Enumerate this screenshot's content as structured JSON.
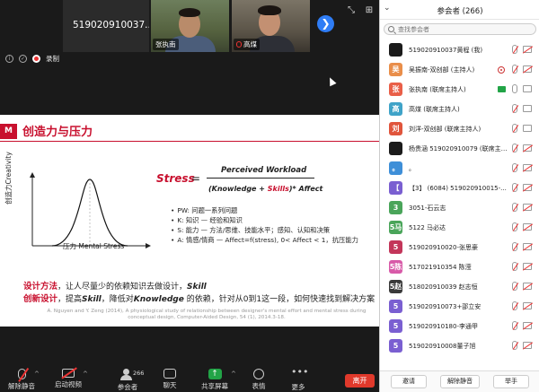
{
  "top_tiles": {
    "id_tile_name": "519020910037...",
    "speakers": [
      {
        "label": "张执南"
      },
      {
        "label": "高煤"
      }
    ]
  },
  "rec_bar": {
    "label": "录制"
  },
  "slide": {
    "logo": "M",
    "title": "创造力与压力",
    "curve": {
      "ylabel": "创造力Creativity",
      "xlabel": "压力 Mental Stress"
    },
    "formula": {
      "lhs": "Stress",
      "eq": "=",
      "numerator": "Perceived Workload",
      "den_a": "(Knowledge + ",
      "den_b": "Skills",
      "den_c": ")* Affect"
    },
    "bullets": [
      "PW: 问题一系列问题",
      "K: 知识 — 经验和知识",
      "S: 能力 — 方法/思维、技能水平；感知、认知和决策",
      "A: 情感/情商 — Affect=f(stress), 0< Affect < 1，抗压能力"
    ],
    "design1": {
      "lead": "设计方法",
      "rest": "，让人尽量少的依赖知识去做设计，",
      "bold": "Skill"
    },
    "design2": {
      "lead": "创新设计",
      "rest1": "，提高",
      "bold1": "Skill",
      "rest2": "，降低对",
      "bold2": "Knowledge",
      "rest3": " 的依赖，针对从0到1这一段，如何快速找到解决方案"
    },
    "citation": "A. Nguyen and Y. Zeng (2014), A physiological study of relationship between designer's mental effort and mental stress during conceptual design, Computer-Aided Design, 54 (1), 2014.3-18."
  },
  "toolbar": {
    "items": [
      {
        "label": "解除静音",
        "icon": "mic-muted-icon"
      },
      {
        "label": "启动视频",
        "icon": "video-off-icon"
      },
      {
        "label": "参会者",
        "icon": "participants-icon",
        "count": "266"
      },
      {
        "label": "聊天",
        "icon": "chat-icon"
      },
      {
        "label": "共享屏幕",
        "icon": "share-screen-icon"
      },
      {
        "label": "表情",
        "icon": "reactions-icon"
      },
      {
        "label": "更多",
        "icon": "more-icon"
      }
    ],
    "leave": "离开"
  },
  "panel": {
    "title": "参会者 (266)",
    "search_placeholder": "查找参会者",
    "participants": [
      {
        "name": "519020910037黄程 (我)",
        "avatar": "",
        "color": "#1b1b1b",
        "photo": true
      },
      {
        "name": "吴振南-双创部 (主持人)",
        "avatar": "吴",
        "color": "#e98e4a"
      },
      {
        "name": "张执南 (联席主持人)",
        "avatar": "张",
        "color": "#e95f48"
      },
      {
        "name": "高煤 (联席主持人)",
        "avatar": "高",
        "color": "#3fa3c8"
      },
      {
        "name": "刘洋-双创部 (联席主持人)",
        "avatar": "刘",
        "color": "#e0553c"
      },
      {
        "name": "杨贵涵 519020910079 (联席主持人)",
        "avatar": "",
        "color": "#1b1b1b",
        "photo": true
      },
      {
        "name": "。",
        "avatar": "。",
        "color": "#3e8fd8"
      },
      {
        "name": "【3】 (6084)  519020910015-...",
        "avatar": "【",
        "color": "#7a5fd1"
      },
      {
        "name": "3051-石云志",
        "avatar": "3",
        "color": "#4aa55a"
      },
      {
        "name": "5122 马必达",
        "avatar": "5马",
        "color": "#4aa55a"
      },
      {
        "name": "519020910020-张思豪",
        "avatar": "5",
        "color": "#c3365a"
      },
      {
        "name": "517021910354 陈滢",
        "avatar": "5陈",
        "color": "#d85aa8"
      },
      {
        "name": "518020910039 赵志恒",
        "avatar": "5赵",
        "color": "#3a3a3a"
      },
      {
        "name": "519020910073+邵立安",
        "avatar": "5",
        "color": "#7a5fd1"
      },
      {
        "name": "519020910180-李通甲",
        "avatar": "5",
        "color": "#7a5fd1"
      },
      {
        "name": "519020910008董子旭",
        "avatar": "5",
        "color": "#7a5fd1"
      }
    ],
    "footer": {
      "invite": "邀请",
      "unmute_all": "解除静音",
      "raise_hand": "举手"
    }
  }
}
